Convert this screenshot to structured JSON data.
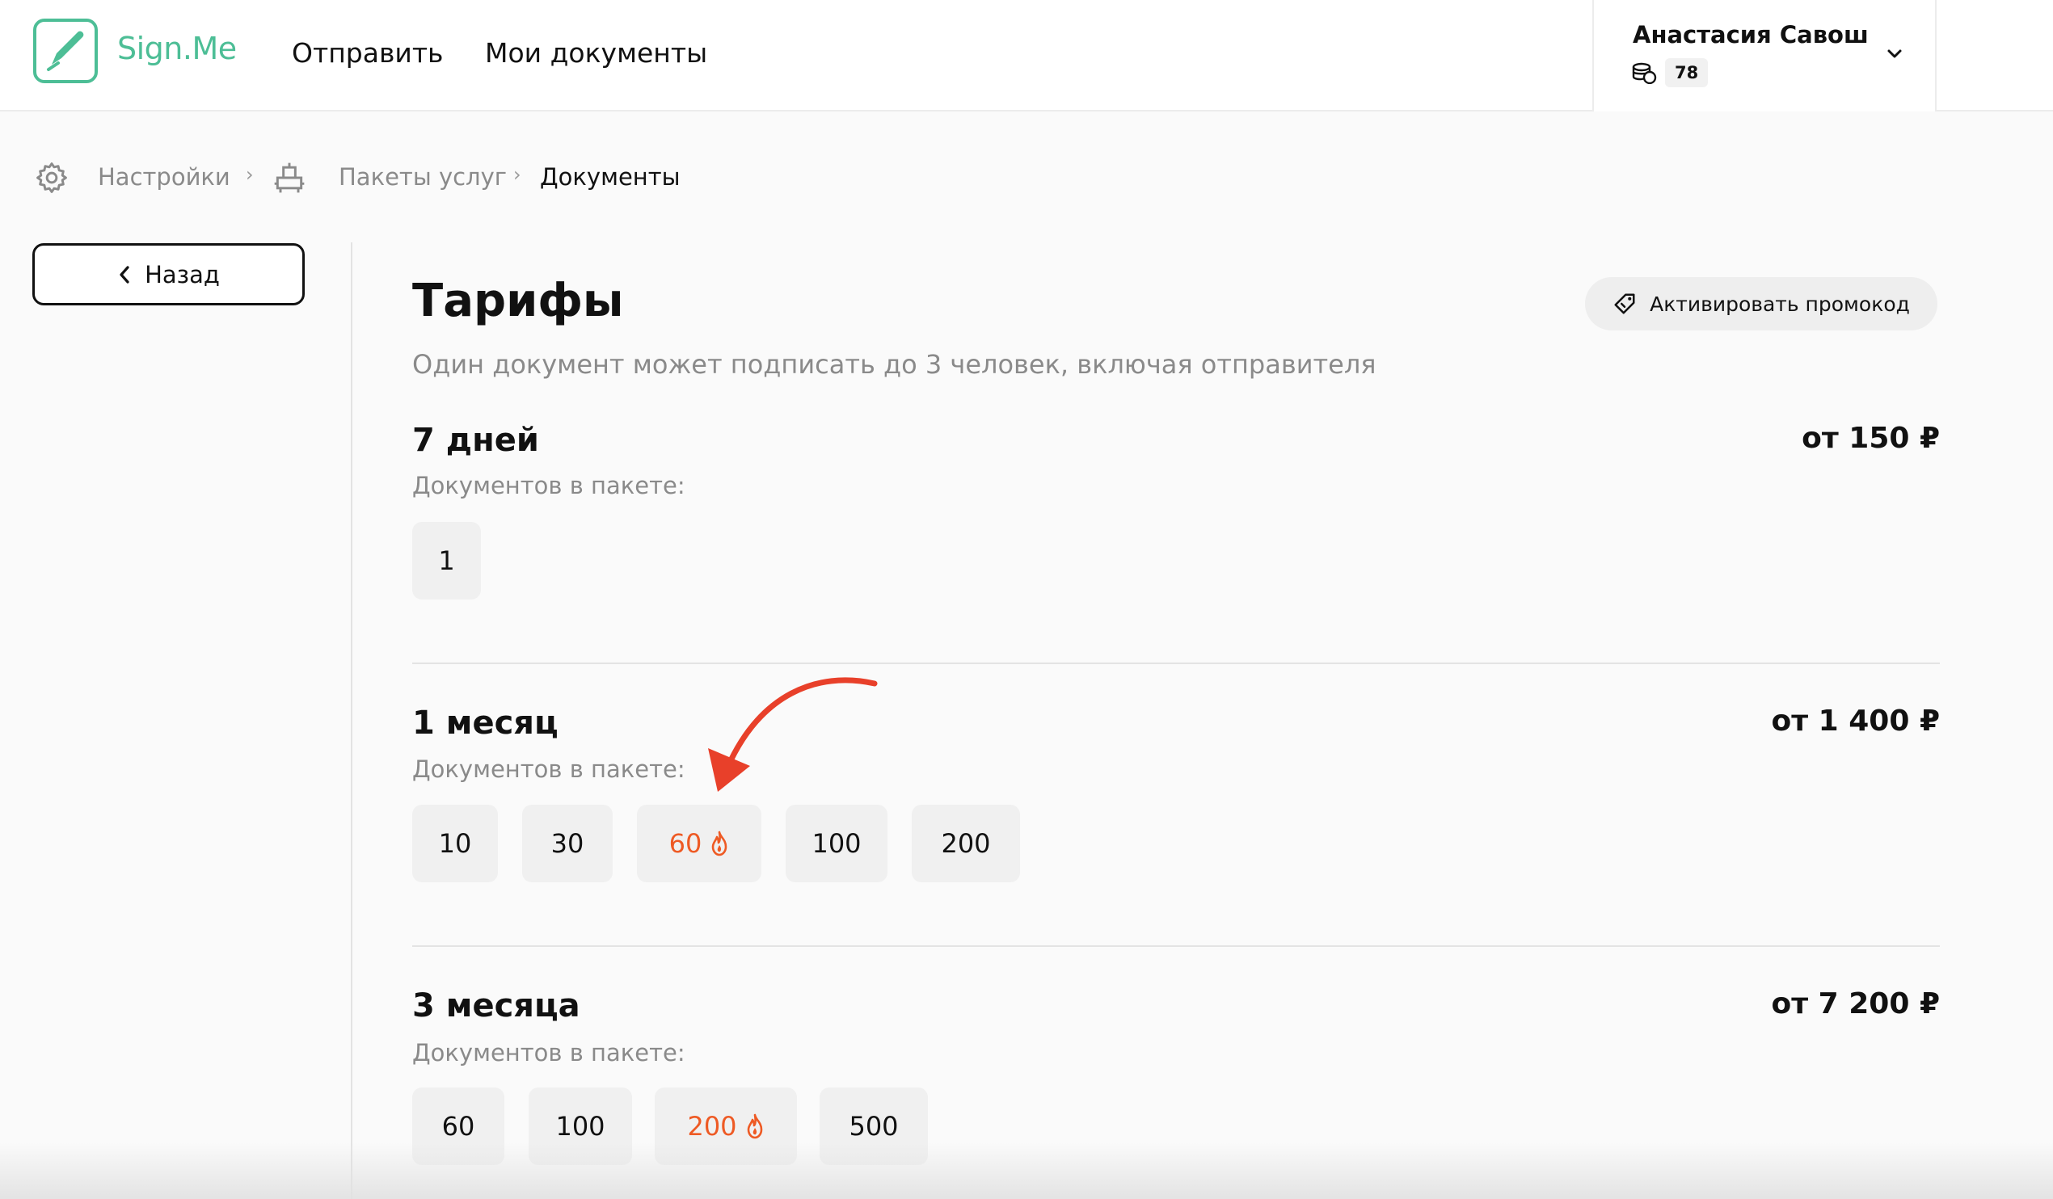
{
  "header": {
    "logo_text": "Sign.Me",
    "nav": [
      "Отправить",
      "Мои документы"
    ],
    "user": {
      "name": "Анастасия Савош",
      "balance": "78"
    }
  },
  "breadcrumb": [
    "Настройки",
    "Пакеты услуг",
    "Документы"
  ],
  "back_label": "Назад",
  "main": {
    "title": "Тарифы",
    "subtitle": "Один документ может подписать до 3 человек, включая отправителя",
    "promo_label": "Активировать промокод",
    "docs_label": "Документов в пакете:",
    "plans": [
      {
        "name": "7 дней",
        "price": "от 150 ₽",
        "options": [
          "1"
        ]
      },
      {
        "name": "1 месяц",
        "price": "от 1 400 ₽",
        "options": [
          "10",
          "30",
          "60",
          "100",
          "200"
        ]
      },
      {
        "name": "3 месяца",
        "price": "от 7 200 ₽",
        "options": [
          "60",
          "100",
          "200",
          "500"
        ]
      }
    ]
  },
  "colors": {
    "brand": "#4dbe96",
    "hot": "#ee5a24",
    "annotation_arrow": "#e8402a"
  },
  "icons": [
    "logo-pen-icon",
    "coins-icon",
    "chevron-down-icon",
    "gear-icon",
    "package-icon",
    "chevron-left-icon",
    "tag-icon",
    "fire-icon"
  ]
}
